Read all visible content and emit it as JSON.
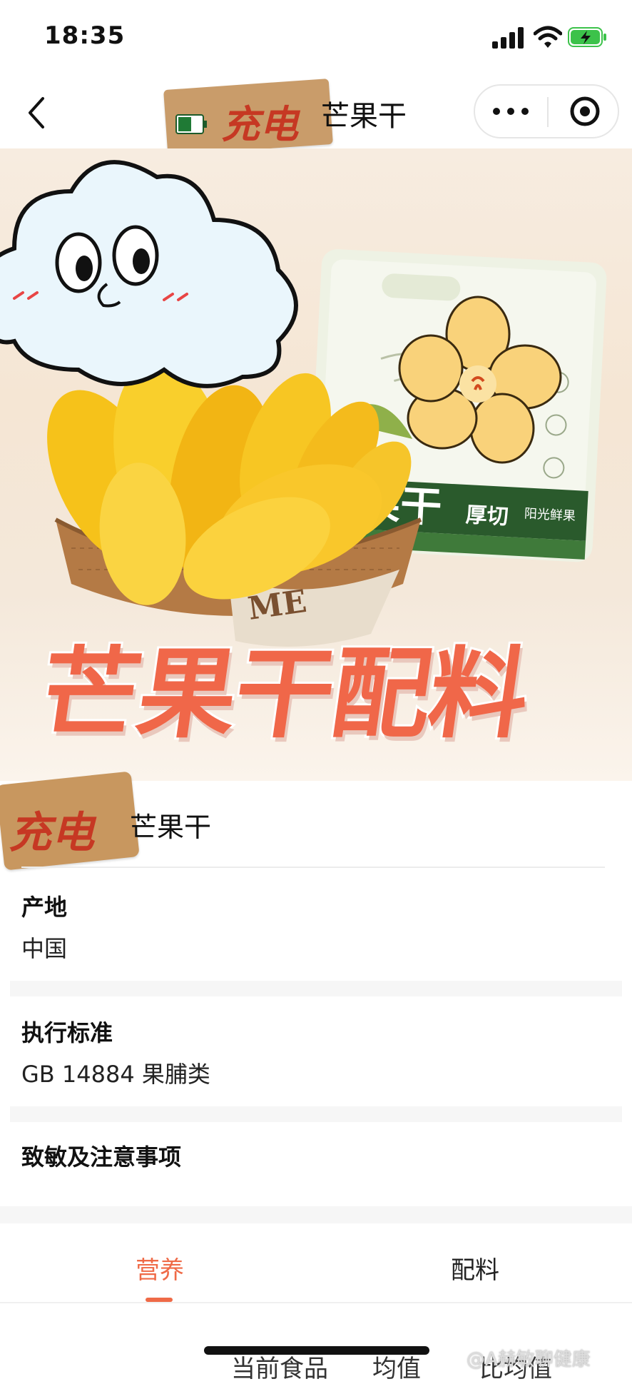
{
  "status_bar": {
    "time": "18:35",
    "battery": "charging"
  },
  "nav": {
    "back_icon": "chevron-left-icon",
    "title": "芒果干",
    "sticker_text": "充电",
    "more_icon": "more-dots-icon",
    "close_icon": "mini-program-close-icon"
  },
  "hero": {
    "headline": "芒果干配料",
    "bag_brand_text": "果干",
    "bag_tag1": "厚切",
    "bag_tag2": "阳光鲜果",
    "basket_text": "ME"
  },
  "product": {
    "sticker_text": "充电",
    "name": "芒果干"
  },
  "sections": [
    {
      "label": "产地",
      "value": "中国"
    },
    {
      "label": "执行标准",
      "value": "GB 14884 果脯类"
    },
    {
      "label": "致敏及注意事项",
      "value": ""
    }
  ],
  "tabs": {
    "items": [
      "营养",
      "配料"
    ],
    "active": "营养",
    "accent": "#ef6a47"
  },
  "sub_tabs": [
    "当前食品",
    "均值",
    "比均值"
  ],
  "watermark": "@A赫敏聊健康"
}
